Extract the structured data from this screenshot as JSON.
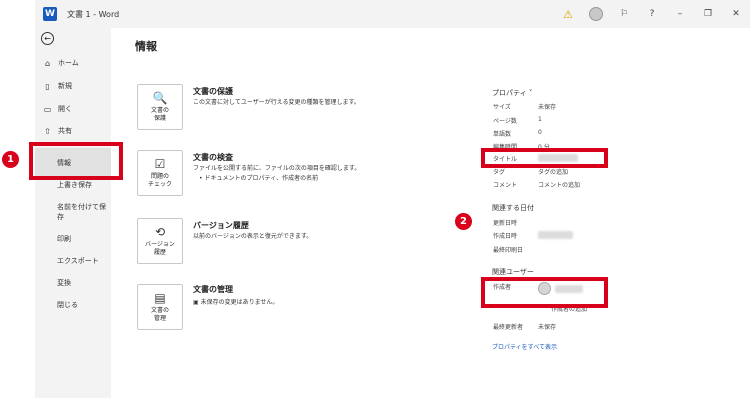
{
  "window": {
    "title": "文書 1 - Word",
    "app_letter": "W",
    "controls": {
      "help": "?",
      "minimize": "–",
      "restore": "❐",
      "close": "✕"
    }
  },
  "sidebar": {
    "back_icon": "arrow-left-icon",
    "items": [
      {
        "label": "ホーム",
        "icon": "home-icon"
      },
      {
        "label": "新規",
        "icon": "new-doc-icon"
      },
      {
        "label": "開く",
        "icon": "open-folder-icon"
      },
      {
        "label": "共有",
        "icon": "share-icon"
      },
      {
        "label": "情報"
      },
      {
        "label": "上書き保存"
      },
      {
        "label": "名前を付けて保存"
      },
      {
        "label": "印刷"
      },
      {
        "label": "エクスポート"
      },
      {
        "label": "変換"
      },
      {
        "label": "閉じる"
      }
    ]
  },
  "main": {
    "title": "情報",
    "sections": [
      {
        "tile": "文書の\n保護",
        "title": "文書の保護",
        "desc": "この文書に対してユーザーが行える変更の種類を管理します。"
      },
      {
        "tile": "問題の\nチェック",
        "title": "文書の検査",
        "desc": "ファイルを公開する前に、ファイルの次の項目を確認します。",
        "bullet": "ドキュメントのプロパティ、作成者の名前"
      },
      {
        "tile": "バージョン\n履歴",
        "title": "バージョン履歴",
        "desc": "以前のバージョンの表示と復元ができます。"
      },
      {
        "tile": "文書の\n管理",
        "title": "文書の管理",
        "desc": "未保存の変更はありません。"
      }
    ]
  },
  "properties": {
    "heading": "プロパティ",
    "rows": [
      {
        "label": "サイズ",
        "value": "未保存"
      },
      {
        "label": "ページ数",
        "value": "1"
      },
      {
        "label": "単語数",
        "value": "0"
      },
      {
        "label": "編集時間",
        "value": "0 分"
      },
      {
        "label": "タイトル",
        "value": ""
      },
      {
        "label": "タグ",
        "value": "タグの追加"
      },
      {
        "label": "コメント",
        "value": "コメントの追加"
      }
    ],
    "dates_heading": "関連する日付",
    "dates": [
      {
        "label": "更新日時",
        "value": ""
      },
      {
        "label": "作成日時",
        "value": ""
      },
      {
        "label": "最終印刷日",
        "value": ""
      }
    ],
    "people_heading": "関連ユーザー",
    "author_label": "作成者",
    "add_author": "作成者の追加",
    "last_modified_label": "最終更新者",
    "last_modified_value": "未保存",
    "show_all": "プロパティをすべて表示"
  },
  "annotations": {
    "badge1": "1",
    "badge2": "2",
    "color": "#d9001b"
  }
}
